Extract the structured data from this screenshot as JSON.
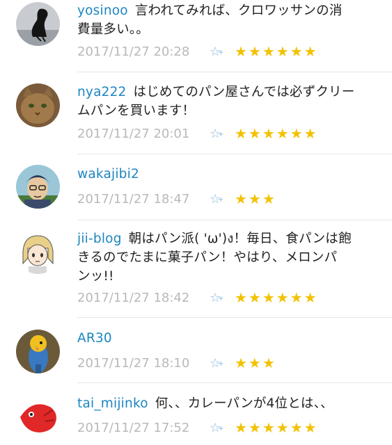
{
  "comments": [
    {
      "user": "yosinoo",
      "text_line1": "言われてみれば、クロワッサンの消",
      "text_line2": "費量多い。。",
      "date": "2017/11/27 20:28",
      "stars": "★★★★★★",
      "avatar": "bird-silhouette"
    },
    {
      "user": "nya222",
      "text_line1": "はじめてのパン屋さんでは必ずクリー",
      "text_line2": "ムパンを買います！",
      "date": "2017/11/27 20:01",
      "stars": "★★★★★★",
      "avatar": "cat-photo"
    },
    {
      "user": "wakajibi2",
      "text_line1": "",
      "text_line2": "",
      "date": "2017/11/27 18:47",
      "stars": "★★★",
      "avatar": "man-with-cap-illustration"
    },
    {
      "user": "jii-blog",
      "text_line1": "朝はパン派( 'ω')ง！毎日、食パンは飽",
      "text_line2": "きるのでたまに菓子パン！やはり、メロンパ",
      "text_line3": "ンッ!!",
      "date": "2017/11/27 18:42",
      "stars": "★★★★★★",
      "avatar": "anime-character"
    },
    {
      "user": "AR30",
      "text_line1": "",
      "text_line2": "",
      "date": "2017/11/27 18:10",
      "stars": "★★★",
      "avatar": "parakeet-photo"
    },
    {
      "user": "tai_mijinko",
      "text_line1": "何、、カレーパンが4位とは、、",
      "text_line2": "",
      "date": "2017/11/27 17:52",
      "stars": "★★★★★★",
      "avatar": "red-fish"
    }
  ],
  "icons": {
    "star_add": "star-plus-icon"
  },
  "colors": {
    "username": "#1c86c0",
    "date": "#b9b9b9",
    "star": "#f2c200",
    "star_add": "#8ab7d8",
    "divider": "#e6e6e6"
  }
}
